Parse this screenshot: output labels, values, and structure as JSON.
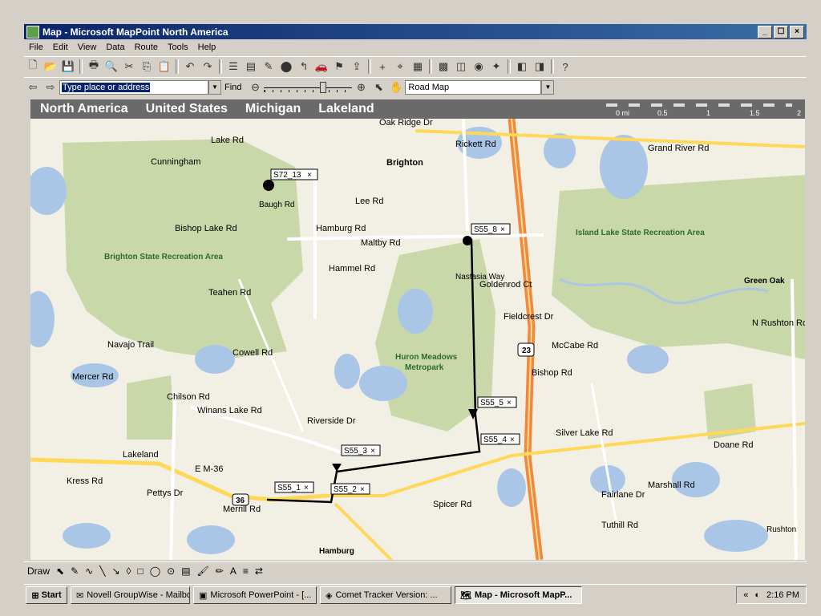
{
  "window": {
    "title": "Map - Microsoft MapPoint North America",
    "min": "_",
    "max": "☐",
    "close": "×"
  },
  "menu": [
    "File",
    "Edit",
    "View",
    "Data",
    "Route",
    "Tools",
    "Help"
  ],
  "nav": {
    "search_value": "Type place or address",
    "find_label": "Find",
    "map_style": "Road Map"
  },
  "breadcrumb": [
    "North America",
    "United States",
    "Michigan",
    "Lakeland"
  ],
  "scale": {
    "labels": [
      "0 mi",
      "0.5",
      "1",
      "1.5",
      "2"
    ]
  },
  "map": {
    "roads": [
      "Oak Ridge Dr",
      "Grand River Rd",
      "Lake Rd",
      "Lee Rd",
      "Rickett Rd",
      "Bishop Lake Rd",
      "Maltby Rd",
      "Hamburg Rd",
      "Hammel Rd",
      "Teahen Rd",
      "Cowell Rd",
      "Navajo Trail",
      "Mercer Rd",
      "Winans Lake Rd",
      "Riverside Dr",
      "Chilson Rd",
      "Lakeland",
      "E M-36",
      "Pettys Dr",
      "Merrill Rd",
      "Spicer Rd",
      "Silver Lake Rd",
      "Doane Rd",
      "Marshall Rd",
      "Fairlane Dr",
      "Tuthill Rd",
      "N Rushton Rd",
      "McCabe Rd",
      "Bishop Rd",
      "Goldenrod Ct",
      "Fieldcrest Dr",
      "Nastasia Way",
      "Kress Rd",
      "Baugh Rd"
    ],
    "places": [
      "Cunningham",
      "Brighton",
      "Brighton State Recreation Area",
      "Island Lake State Recreation Area",
      "Green Oak",
      "Huron Meadows",
      "Metropark",
      "Hamburg",
      "Rushton"
    ],
    "shields": [
      "23",
      "36"
    ],
    "pins": [
      "S72_13",
      "S55_8",
      "S55_5",
      "S55_4",
      "S55_3",
      "S55_2",
      "S55_1"
    ],
    "colors": {
      "park": "#c9d8a8",
      "water": "#aac6e6",
      "highway": "#f08a3a",
      "road": "#ffffff",
      "route": "#000000"
    }
  },
  "drawbar": {
    "draw_label": "Draw"
  },
  "taskbar": {
    "start": "Start",
    "tasks": [
      "Novell GroupWise - Mailbox",
      "Microsoft PowerPoint - [...",
      "Comet Tracker Version: ...",
      "Map - Microsoft MapP..."
    ],
    "clock": "2:16 PM"
  }
}
